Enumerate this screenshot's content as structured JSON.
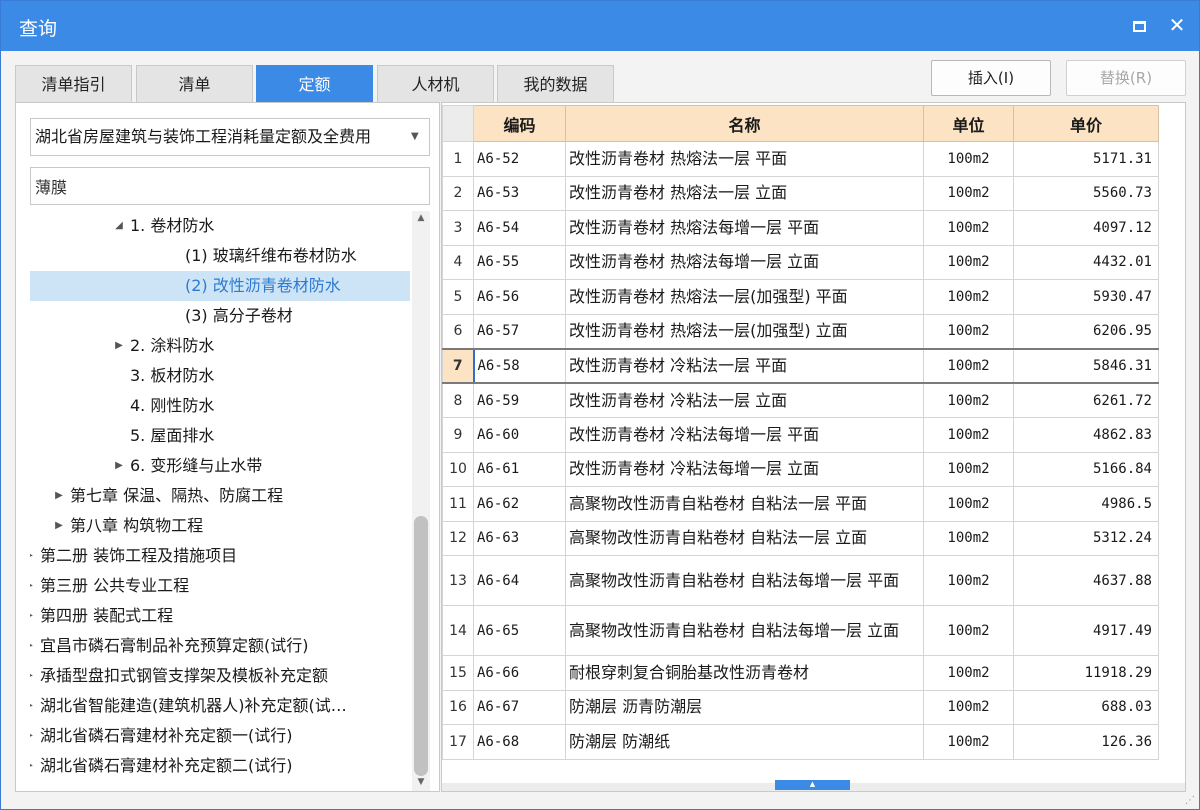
{
  "window": {
    "title": "查询"
  },
  "tabs": [
    {
      "label": "清单指引",
      "active": false
    },
    {
      "label": "清单",
      "active": false
    },
    {
      "label": "定额",
      "active": true
    },
    {
      "label": "人材机",
      "active": false
    },
    {
      "label": "我的数据",
      "active": false
    }
  ],
  "actions": {
    "insert_label": "插入(I)",
    "replace_label": "替换(R)"
  },
  "library_select": {
    "value": "湖北省房屋建筑与装饰工程消耗量定额及全费用"
  },
  "search": {
    "value": "薄膜"
  },
  "tree": [
    {
      "label": "1. 卷材防水",
      "level": 3,
      "expander": "expanded",
      "selected": false
    },
    {
      "label": "(1) 玻璃纤维布卷材防水",
      "level": 4,
      "expander": "none",
      "selected": false
    },
    {
      "label": "(2) 改性沥青卷材防水",
      "level": 4,
      "expander": "none",
      "selected": true
    },
    {
      "label": "(3) 高分子卷材",
      "level": 4,
      "expander": "none",
      "selected": false
    },
    {
      "label": "2. 涂料防水",
      "level": 3,
      "expander": "collapsed",
      "selected": false
    },
    {
      "label": "3. 板材防水",
      "level": 3,
      "expander": "none",
      "selected": false
    },
    {
      "label": "4. 刚性防水",
      "level": 3,
      "expander": "none",
      "selected": false
    },
    {
      "label": "5. 屋面排水",
      "level": 3,
      "expander": "none",
      "selected": false
    },
    {
      "label": "6. 变形缝与止水带",
      "level": 3,
      "expander": "collapsed",
      "selected": false
    },
    {
      "label": "第七章 保温、隔热、防腐工程",
      "level": 2,
      "expander": "collapsed",
      "selected": false
    },
    {
      "label": "第八章 构筑物工程",
      "level": 2,
      "expander": "collapsed",
      "selected": false
    },
    {
      "label": "第二册 装饰工程及措施项目",
      "level": 1,
      "expander": "collapsed",
      "selected": false
    },
    {
      "label": "第三册 公共专业工程",
      "level": 1,
      "expander": "collapsed",
      "selected": false
    },
    {
      "label": "第四册 装配式工程",
      "level": 1,
      "expander": "collapsed",
      "selected": false
    },
    {
      "label": "宜昌市磷石膏制品补充预算定额(试行)",
      "level": 1,
      "expander": "collapsed",
      "selected": false
    },
    {
      "label": "承插型盘扣式钢管支撑架及模板补充定额",
      "level": 1,
      "expander": "collapsed",
      "selected": false
    },
    {
      "label": "湖北省智能建造(建筑机器人)补充定额(试…",
      "level": 1,
      "expander": "collapsed",
      "selected": false
    },
    {
      "label": "湖北省磷石膏建材补充定额一(试行)",
      "level": 1,
      "expander": "collapsed",
      "selected": false
    },
    {
      "label": "湖北省磷石膏建材补充定额二(试行)",
      "level": 1,
      "expander": "collapsed",
      "selected": false
    }
  ],
  "grid": {
    "columns": [
      "编码",
      "名称",
      "单位",
      "单价"
    ],
    "current_row": 7,
    "rows": [
      {
        "idx": "1",
        "code": "A6-52",
        "name": "改性沥青卷材 热熔法一层 平面",
        "unit": "100m2",
        "price": "5171.31"
      },
      {
        "idx": "2",
        "code": "A6-53",
        "name": "改性沥青卷材 热熔法一层 立面",
        "unit": "100m2",
        "price": "5560.73"
      },
      {
        "idx": "3",
        "code": "A6-54",
        "name": "改性沥青卷材 热熔法每增一层 平面",
        "unit": "100m2",
        "price": "4097.12"
      },
      {
        "idx": "4",
        "code": "A6-55",
        "name": "改性沥青卷材 热熔法每增一层 立面",
        "unit": "100m2",
        "price": "4432.01"
      },
      {
        "idx": "5",
        "code": "A6-56",
        "name": "改性沥青卷材 热熔法一层(加强型) 平面",
        "unit": "100m2",
        "price": "5930.47"
      },
      {
        "idx": "6",
        "code": "A6-57",
        "name": "改性沥青卷材 热熔法一层(加强型) 立面",
        "unit": "100m2",
        "price": "6206.95"
      },
      {
        "idx": "7",
        "code": "A6-58",
        "name": "改性沥青卷材 冷粘法一层 平面",
        "unit": "100m2",
        "price": "5846.31"
      },
      {
        "idx": "8",
        "code": "A6-59",
        "name": "改性沥青卷材 冷粘法一层 立面",
        "unit": "100m2",
        "price": "6261.72"
      },
      {
        "idx": "9",
        "code": "A6-60",
        "name": "改性沥青卷材 冷粘法每增一层 平面",
        "unit": "100m2",
        "price": "4862.83"
      },
      {
        "idx": "10",
        "code": "A6-61",
        "name": "改性沥青卷材 冷粘法每增一层 立面",
        "unit": "100m2",
        "price": "5166.84"
      },
      {
        "idx": "11",
        "code": "A6-62",
        "name": "高聚物改性沥青自粘卷材 自粘法一层 平面",
        "unit": "100m2",
        "price": "4986.5"
      },
      {
        "idx": "12",
        "code": "A6-63",
        "name": "高聚物改性沥青自粘卷材 自粘法一层 立面",
        "unit": "100m2",
        "price": "5312.24"
      },
      {
        "idx": "13",
        "code": "A6-64",
        "name": "高聚物改性沥青自粘卷材 自粘法每增一层 平面",
        "unit": "100m2",
        "price": "4637.88"
      },
      {
        "idx": "14",
        "code": "A6-65",
        "name": "高聚物改性沥青自粘卷材 自粘法每增一层 立面",
        "unit": "100m2",
        "price": "4917.49"
      },
      {
        "idx": "15",
        "code": "A6-66",
        "name": "耐根穿刺复合铜胎基改性沥青卷材",
        "unit": "100m2",
        "price": "11918.29"
      },
      {
        "idx": "16",
        "code": "A6-67",
        "name": "防潮层 沥青防潮层",
        "unit": "100m2",
        "price": "688.03"
      },
      {
        "idx": "17",
        "code": "A6-68",
        "name": "防潮层 防潮纸",
        "unit": "100m2",
        "price": "126.36"
      }
    ]
  },
  "colors": {
    "accent": "#3b8ae6",
    "header_bg": "#fbe3c4",
    "selected_tree_bg": "#cde4f7"
  }
}
